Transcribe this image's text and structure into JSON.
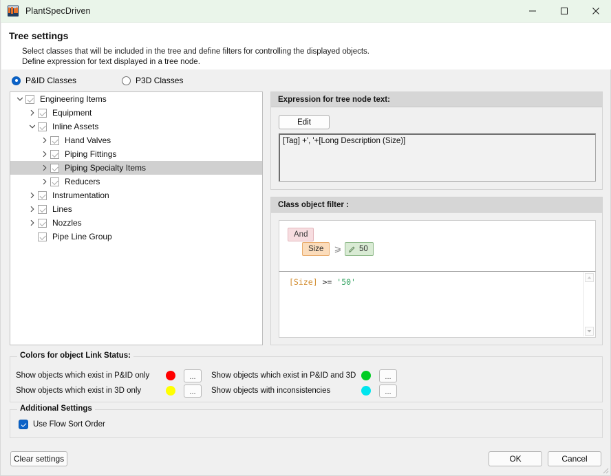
{
  "window": {
    "title": "PlantSpecDriven",
    "icon": "plant-app-icon",
    "minimize": "minimize-icon",
    "maximize": "maximize-icon",
    "close": "close-icon"
  },
  "header": {
    "title": "Tree settings",
    "desc_line1": "Select classes that will be included in the tree and define filters for controlling the displayed objects.",
    "desc_line2": "Define expression for text displayed in a tree node."
  },
  "class_mode": {
    "options": [
      {
        "label": "P&ID Classes",
        "selected": true
      },
      {
        "label": "P3D Classes",
        "selected": false
      }
    ]
  },
  "tree": {
    "nodes": [
      {
        "label": "Engineering Items",
        "depth": 0,
        "expander": "chevron-down",
        "checked": true,
        "selected": false
      },
      {
        "label": "Equipment",
        "depth": 1,
        "expander": "chevron-right",
        "checked": true,
        "selected": false
      },
      {
        "label": "Inline Assets",
        "depth": 1,
        "expander": "chevron-down",
        "checked": true,
        "selected": false
      },
      {
        "label": "Hand Valves",
        "depth": 2,
        "expander": "chevron-right",
        "checked": true,
        "selected": false
      },
      {
        "label": "Piping Fittings",
        "depth": 2,
        "expander": "chevron-right",
        "checked": true,
        "selected": false
      },
      {
        "label": "Piping Specialty Items",
        "depth": 2,
        "expander": "chevron-right",
        "checked": true,
        "selected": true
      },
      {
        "label": "Reducers",
        "depth": 2,
        "expander": "chevron-right",
        "checked": true,
        "selected": false
      },
      {
        "label": "Instrumentation",
        "depth": 1,
        "expander": "chevron-right",
        "checked": true,
        "selected": false
      },
      {
        "label": "Lines",
        "depth": 1,
        "expander": "chevron-right",
        "checked": true,
        "selected": false
      },
      {
        "label": "Nozzles",
        "depth": 1,
        "expander": "chevron-right",
        "checked": true,
        "selected": false
      },
      {
        "label": "Pipe Line Group",
        "depth": 1,
        "expander": "none",
        "checked": true,
        "selected": false
      }
    ]
  },
  "expression_panel": {
    "title": "Expression for tree node text:",
    "edit_label": "Edit",
    "value": "[Tag] +', '+[Long Description (Size)]"
  },
  "filter_panel": {
    "title": "Class object filter :",
    "builder": {
      "logic_chip": "And",
      "field_chip": "Size",
      "operator": "⩾",
      "value_chip": "50",
      "value_icon": "pencil-icon"
    },
    "code": {
      "field": "[Size]",
      "operator": ">=",
      "value": "'50'"
    },
    "scroll_up": "scroll-up-arrow",
    "scroll_down": "scroll-down-arrow"
  },
  "colors_group": {
    "legend": "Colors for object Link Status:",
    "rows": [
      {
        "label": "Show objects which exist in P&ID only",
        "color": "#ff0000",
        "button": "..."
      },
      {
        "label": "Show objects which exist in 3D only",
        "color": "#ffff00",
        "button": "..."
      },
      {
        "label": "Show objects which exist in P&ID and 3D",
        "color": "#00cc22",
        "button": "..."
      },
      {
        "label": "Show objects with inconsistencies",
        "color": "#00e5ee",
        "button": "..."
      }
    ]
  },
  "additional_settings": {
    "legend": "Additional Settings",
    "checkbox_label": "Use Flow Sort Order",
    "checked": true
  },
  "footer": {
    "clear_label": "Clear settings",
    "ok_label": "OK",
    "cancel_label": "Cancel"
  }
}
